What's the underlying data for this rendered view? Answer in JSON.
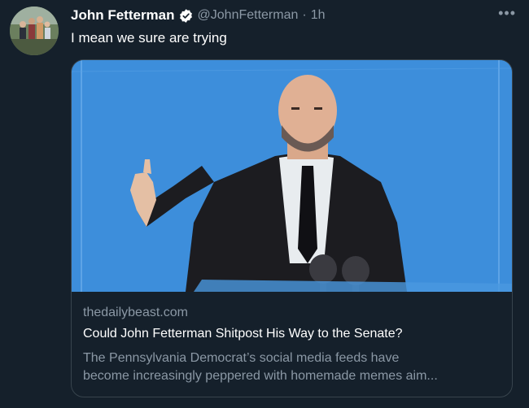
{
  "tweet": {
    "author_name": "John Fetterman",
    "verified_icon": "verified-badge-icon",
    "handle": "@JohnFetterman",
    "separator": "·",
    "time": "1h",
    "more_icon": "more-horizontal-icon",
    "more_label": "•••",
    "text": "I mean we sure are trying"
  },
  "card": {
    "image_desc": "man-in-suit-at-podium-icon",
    "domain": "thedailybeast.com",
    "title": "Could John Fetterman Shitpost His Way to the Senate?",
    "description_line1": "The Pennsylvania Democrat’s social media feeds have",
    "description_line2": "become increasingly peppered with homemade memes aim..."
  },
  "colors": {
    "background": "#15202b",
    "secondary_text": "#8b98a5",
    "border": "#38444d",
    "verified_blue": "#ffffff",
    "card_image_blue": "#3d8edb"
  }
}
